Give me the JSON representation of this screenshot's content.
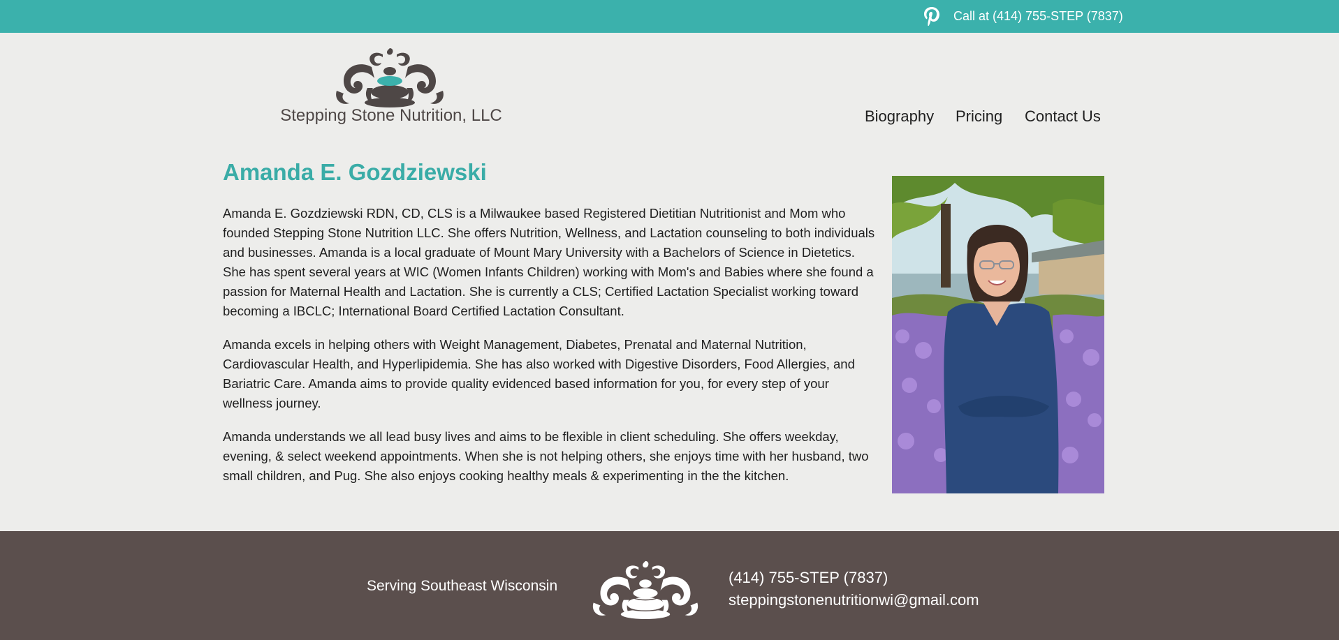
{
  "colors": {
    "brand_teal": "#3bb1ac",
    "brand_brown": "#5b4f4d",
    "page_background": "#ededeb",
    "heading_teal": "#3aaca7"
  },
  "header": {
    "social_icon": "pinterest-icon",
    "call_text": "Call at (414) 755-STEP (7837)"
  },
  "logo": {
    "icon": "stacked-stones-ornament-icon",
    "text": "Stepping Stone Nutrition, LLC"
  },
  "nav": {
    "items": [
      {
        "label": "Biography"
      },
      {
        "label": "Pricing"
      },
      {
        "label": "Contact Us"
      }
    ]
  },
  "main": {
    "title": "Amanda E. Gozdziewski",
    "paragraphs": [
      "Amanda E. Gozdziewski RDN, CD, CLS is a Milwaukee based Registered Dietitian Nutritionist and Mom who founded Stepping Stone Nutrition LLC. She offers Nutrition, Wellness, and Lactation counseling to both individuals and businesses. Amanda is a local graduate of Mount Mary University with a Bachelors of Science in Dietetics. She has spent several years at WIC (Women Infants Children) working with Mom's and Babies where she found a passion for Maternal Health and Lactation. She is currently a CLS; Certified Lactation Specialist working toward becoming a IBCLC; International Board Certified Lactation Consultant.",
      "Amanda excels in helping others with Weight Management, Diabetes, Prenatal and Maternal Nutrition, Cardiovascular Health, and Hyperlipidemia. She has also worked with Digestive Disorders, Food Allergies, and Bariatric Care. Amanda aims to provide quality evidenced based information for you, for every step of your wellness journey.",
      "Amanda understands we all lead busy lives and aims to be flexible in client scheduling. She offers weekday, evening, & select weekend appointments. When she is not helping others, she enjoys time with her husband, two small children, and Pug. She also enjoys cooking healthy meals & experimenting in the the kitchen."
    ],
    "photo_icon": "portrait-photo"
  },
  "footer": {
    "serving_text": "Serving Southeast Wisconsin",
    "icon": "stacked-stones-ornament-icon",
    "phone": "(414) 755-STEP (7837)",
    "email": "steppingstonenutritionwi@gmail.com"
  }
}
